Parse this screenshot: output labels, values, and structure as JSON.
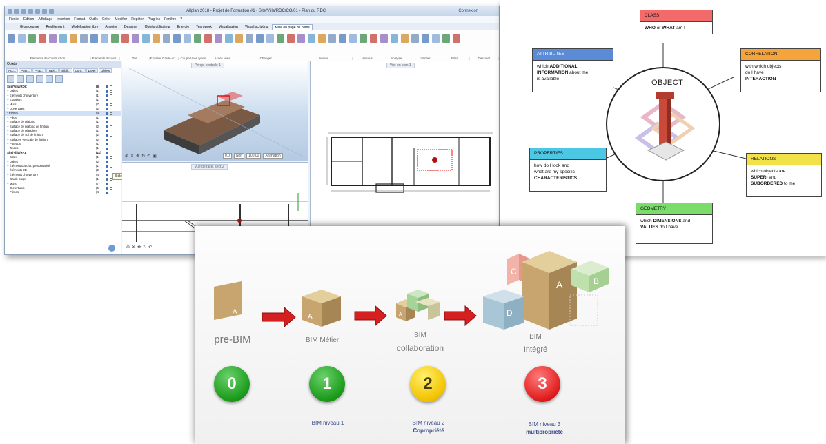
{
  "cad": {
    "title": "Allplan 2018 - Projet de Formation #1 - Site/Villa/RDC/CO/01 - Plan du RDC",
    "connection": "Connexion",
    "menu": [
      "Fichier",
      "Edition",
      "Affichage",
      "Insertion",
      "Format",
      "Outils",
      "Créer",
      "Modifier",
      "Répéter",
      "Plug-ins",
      "Fenêtre",
      "?"
    ],
    "ribbon_tabs": [
      "Gros oeuvre",
      "Revêtement",
      "Modélisation libre",
      "Annoter",
      "Dessiner",
      "Objets utilisateur",
      "Energie",
      "Teamwork",
      "Visualisation",
      "Visual scripting",
      "Mise en page de plans"
    ],
    "ribbon_groups": [
      "Eléments de construction",
      "Eléments d'ouver...",
      "Toit",
      "Escalier  Garde-co...",
      "Coupe  Vues types",
      "Accès vues",
      "Changer",
      "Ancrer",
      "Verrous",
      "Analyse",
      "Vérifier",
      "Filtre",
      "Dessiner"
    ],
    "panel_title": "Objets",
    "panel_tabs": [
      "Acc...",
      "Plan...",
      "Prop...",
      "Tabl...",
      "Bibli...",
      "Con...",
      "Layer",
      "Objets"
    ],
    "tree": [
      {
        "name": "Site/Villa/RDC",
        "count": "(8)",
        "bold": true
      },
      {
        "name": "+ Dalles",
        "count": "(1)"
      },
      {
        "name": "+ Éléments d'ouverture",
        "count": "(1)"
      },
      {
        "name": "+ Escaliers",
        "count": "(1)"
      },
      {
        "name": "+ Murs",
        "count": "(7)"
      },
      {
        "name": "+ Ouvertures",
        "count": "(2)"
      },
      {
        "name": "- Pièces",
        "count": "(4)",
        "selected": true
      },
      {
        "name": "   + Pièce",
        "count": "(1)"
      },
      {
        "name": "   + Surface de plafond",
        "count": "(1)"
      },
      {
        "name": "   + Surface de plafond de finition",
        "count": "(2)"
      },
      {
        "name": "   + Surface de plancher",
        "count": "(1)"
      },
      {
        "name": "   + Surface de sol de finition",
        "count": "(2)"
      },
      {
        "name": "   + Surfaces verticale de finition",
        "count": "(2)"
      },
      {
        "name": "+ Poteaux",
        "count": "(1)"
      },
      {
        "name": "+ Textes",
        "count": "(1)"
      },
      {
        "name": "Site/Villa/R+1",
        "count": "(11)",
        "bold": true
      },
      {
        "name": "+ Cotes",
        "count": "(1)"
      },
      {
        "name": "+ Dalles",
        "count": "(2)"
      },
      {
        "name": "+ Élément d'archit. personnalisé",
        "count": "(1)"
      },
      {
        "name": "+ Éléments 2D",
        "count": "(2)"
      },
      {
        "name": "+ Éléments d'ouverture",
        "count": "(4)"
      },
      {
        "name": "+ Garde-corps",
        "count": "(1)"
      },
      {
        "name": "+ Murs",
        "count": "(7)"
      },
      {
        "name": "+ Ouvertures",
        "count": "(5)"
      },
      {
        "name": "+ Pièces",
        "count": "(4)"
      }
    ],
    "tooltip": "Sélection",
    "view3d_label": "Persp. centrale 1",
    "viewsect_label": "Vue de face, sect.2",
    "viewplan_label": "Vue en plan 1",
    "view_controls": [
      "0.0",
      "Non",
      "100.00",
      "Animation"
    ]
  },
  "object_diagram": {
    "center": "OBJECT",
    "cards": {
      "class": {
        "title": "CLASS",
        "line1_b": "WHO",
        "line1": " or ",
        "line1_b2": "WHAT",
        "line1_end": " am I",
        "color": "#f26a6a"
      },
      "attributes": {
        "title": "ATTRIBUTES",
        "l1": "which ",
        "l1_b": "ADDITIONAL",
        "l2_b": "INFORMATION",
        "l2": " about me",
        "l3": "is available",
        "color": "#5b8bd6"
      },
      "correlation": {
        "title": "CORRELATION",
        "l1": "with which objects",
        "l2": "do I have",
        "l3_b": "INTERACTION",
        "color": "#f5a43c"
      },
      "properties": {
        "title": "PROPERTIES",
        "l1": "how do I look and",
        "l2": "what are my specific",
        "l3_b": "CHARACTERISTICS",
        "color": "#4dc8e4"
      },
      "relations": {
        "title": "RELATIONS",
        "l1": "which objects are",
        "l2_b": "SUPER-",
        "l2": " and",
        "l3_b": "SUBORDERED",
        "l3": " to me",
        "color": "#f2e24a"
      },
      "geometry": {
        "title": "GEOMETRY",
        "l1": "which ",
        "l1_b": "DIMENSIONS",
        "l1_end": " and",
        "l2_b": "VALUES",
        "l2": " do I have",
        "color": "#7bdc6a"
      }
    }
  },
  "bim": {
    "stages": [
      {
        "title": "pre-BIM",
        "subtitle": "",
        "number": "0",
        "color_class": "green",
        "level": "",
        "sub": ""
      },
      {
        "title": "BIM Métier",
        "subtitle": "",
        "number": "1",
        "color_class": "green",
        "level": "BIM niveau 1",
        "sub": ""
      },
      {
        "title": "BIM",
        "subtitle": "collaboration",
        "number": "2",
        "color_class": "yellow",
        "level": "BIM niveau 2",
        "sub": "Copropriété"
      },
      {
        "title": "BIM",
        "subtitle": "Intégré",
        "number": "3",
        "color_class": "red",
        "level": "BIM niveau 3",
        "sub": "multipropriété"
      }
    ],
    "cube_letters": [
      "A",
      "A",
      "A",
      "C",
      "A",
      "B",
      "D"
    ]
  },
  "colors": {
    "accent": "#2a5aa0",
    "arrow": "#d42020",
    "cube_tan": "#c8a56e"
  }
}
